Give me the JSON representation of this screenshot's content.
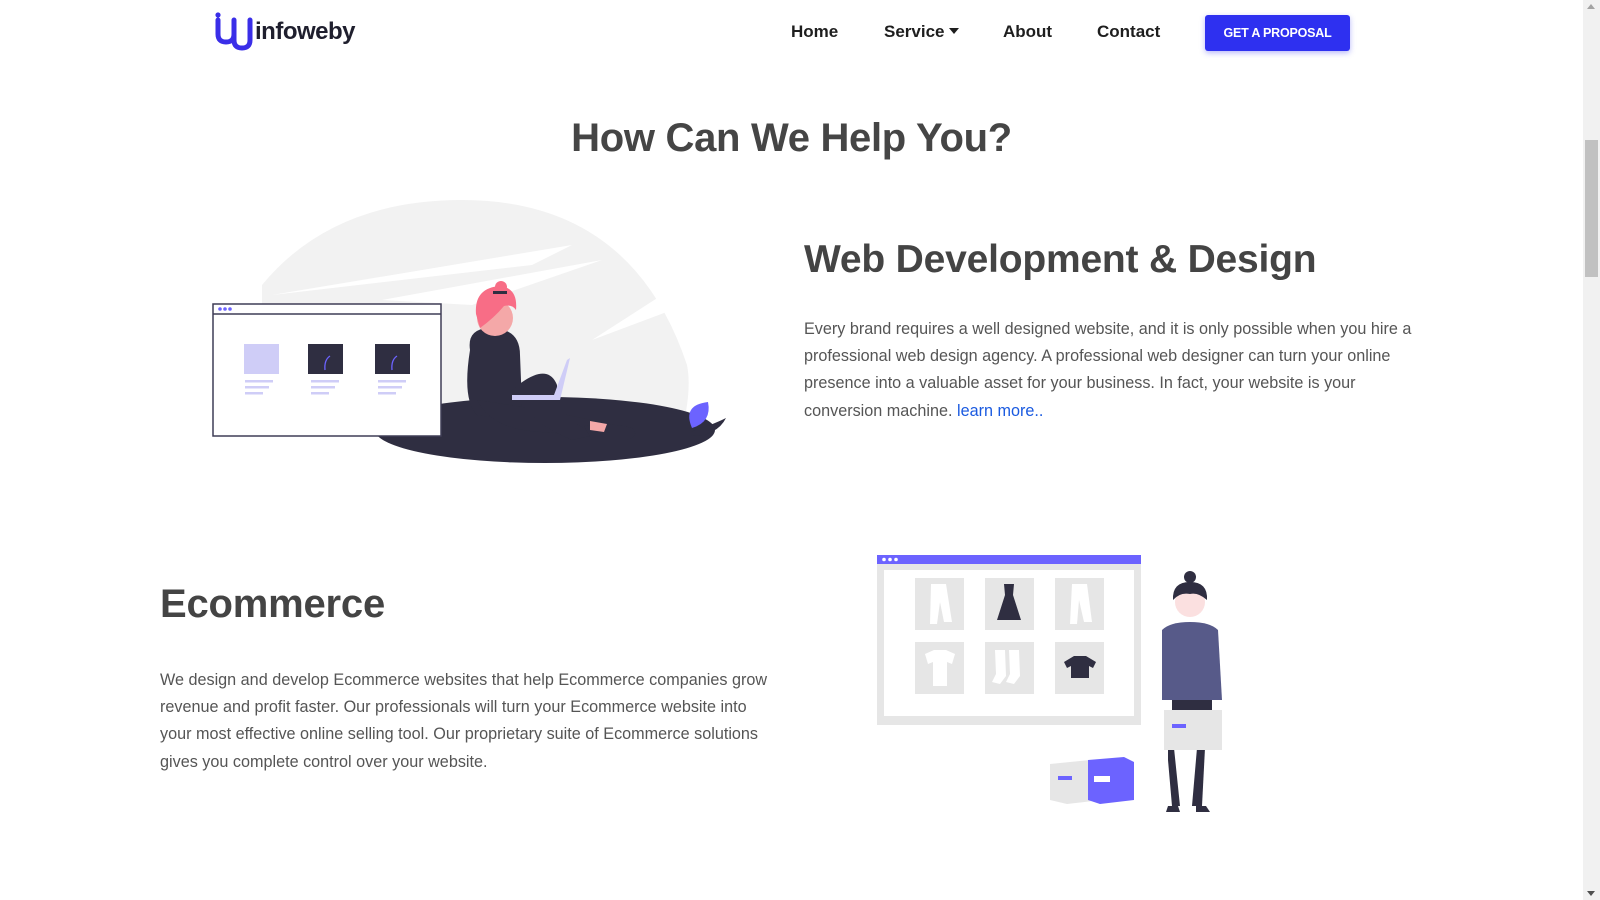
{
  "header": {
    "logo_text": "infoweby",
    "nav": {
      "home": "Home",
      "service": "Service",
      "about": "About",
      "contact": "Contact"
    },
    "cta_label": "GET A PROPOSAL"
  },
  "main": {
    "title": "How Can We Help You?"
  },
  "sections": [
    {
      "title": "Web Development & Design",
      "body": "Every brand requires a well designed website, and it is only possible when you hire a professional web design agency. A professional web designer can turn your online presence into a valuable asset for your business. In fact, your website is your conversion machine.",
      "link": "learn more.."
    },
    {
      "title": "Ecommerce",
      "body": "We design and develop Ecommerce websites that help Ecommerce companies grow revenue and profit faster. Our professionals will turn your Ecommerce website into your most effective online selling tool. Our proprietary suite of Ecommerce solutions gives you complete control over your website."
    }
  ],
  "colors": {
    "brand": "#2e30f0",
    "accent_purple": "#6c63ff",
    "dark_figure": "#2f2e41",
    "hair_pink": "#f86d86"
  }
}
